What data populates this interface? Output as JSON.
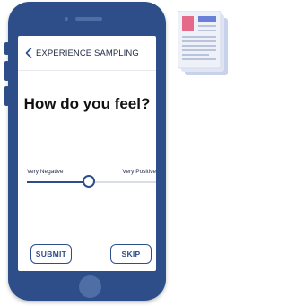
{
  "header": {
    "title": "EXPERIENCE SAMPLING",
    "back_icon": "chevron-left-icon"
  },
  "question": "How do you feel?",
  "slider": {
    "min_label": "Very Negative",
    "max_label": "Very Positive",
    "value": 0.48
  },
  "buttons": {
    "submit": "SUBMIT",
    "skip": "SKIP"
  },
  "colors": {
    "phone": "#2d4e88",
    "accent": "#2d4e88",
    "doc_pink": "#e56a8a",
    "doc_blue": "#6a7fd8"
  },
  "decor": {
    "doc_icon": "document-icon"
  }
}
